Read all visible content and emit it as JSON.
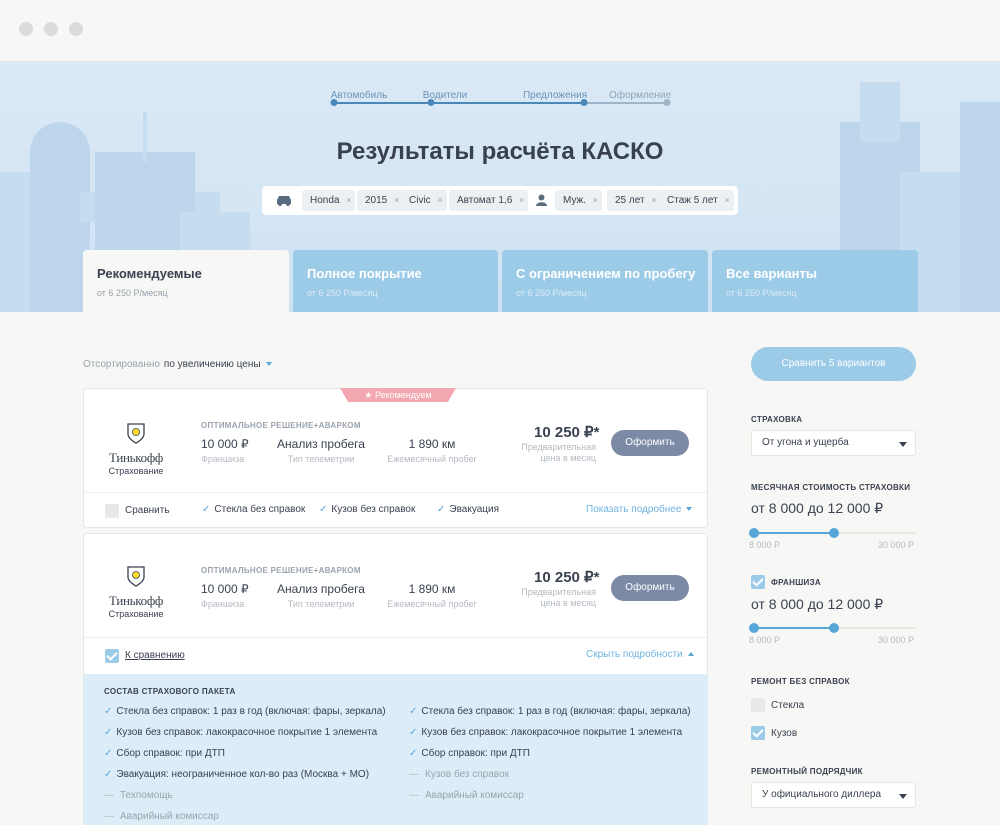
{
  "steps": [
    "Автомобиль",
    "Водители",
    "Предложения",
    "Оформление"
  ],
  "title": "Результаты расчёта КАСКО",
  "car_chips": [
    "Honda",
    "2015",
    "Civic",
    "Автомат 1,6"
  ],
  "driver_chips": [
    "Муж.",
    "25 лет",
    "Стаж 5 лет"
  ],
  "remove_glyph": "×",
  "tabs": [
    {
      "title": "Рекомендуемые",
      "sub": "от 6 250 Р/месяц"
    },
    {
      "title": "Полное покрытие",
      "sub": "от 6 250 Р/месяц"
    },
    {
      "title": "С ограничением по пробегу",
      "sub": "от 6 250 Р/месяц"
    },
    {
      "title": "Все варианты",
      "sub": "от 6 250 Р/месяц"
    }
  ],
  "sort": {
    "label": "Отсортированно",
    "value": "по увеличению цены"
  },
  "offers": [
    {
      "badge": "Рекомендуем",
      "company": "Тинькофф",
      "company_sub": "Страхование",
      "plan": "ОПТИМАЛЬНОЕ РЕШЕНИЕ+АВАРКОМ",
      "franchise": {
        "value": "10 000 ₽",
        "label": "Франшиза"
      },
      "telemetry": {
        "value": "Анализ пробега",
        "label": "Тип телеметрии"
      },
      "mileage": {
        "value": "1 890 км",
        "label": "Ежемесячный пробег"
      },
      "price": "10 250 ₽*",
      "price_note": "Предварительная цена в месяц",
      "cta": "Оформить",
      "compare": "Сравнить",
      "features": [
        "Стекла без справок",
        "Кузов без справок",
        "Эвакуация"
      ],
      "details_link": "Показать подробнее"
    },
    {
      "company": "Тинькофф",
      "company_sub": "Страхование",
      "plan": "ОПТИМАЛЬНОЕ РЕШЕНИЕ+АВАРКОМ",
      "franchise": {
        "value": "10 000 ₽",
        "label": "Франшиза"
      },
      "telemetry": {
        "value": "Анализ пробега",
        "label": "Тип телеметрии"
      },
      "mileage": {
        "value": "1 890 км",
        "label": "Ежемесячный пробег"
      },
      "price": "10 250 ₽*",
      "price_note": "Предварительная цена в месяц",
      "cta": "Оформить",
      "compare": "К сравнению",
      "details_link": "Скрыть подробности"
    }
  ],
  "package": {
    "title": "СОСТАВ СТРАХОВОГО ПАКЕТА",
    "left": [
      {
        "text": "Стекла без справок: 1 раз в год (включая: фары, зеркала)",
        "on": true
      },
      {
        "text": "Кузов без справок: лакокрасочное покрытие 1 элемента",
        "on": true
      },
      {
        "text": "Сбор справок: при ДТП",
        "on": true
      },
      {
        "text": "Эвакуация: неограниченное кол-во раз (Москва + МО)",
        "on": true
      },
      {
        "text": "Техпомощь",
        "on": false
      },
      {
        "text": "Аварийный комиссар",
        "on": false
      }
    ],
    "right": [
      {
        "text": "Стекла без справок: 1 раз в год (включая: фары, зеркала)",
        "on": true
      },
      {
        "text": "Кузов без справок: лакокрасочное покрытие 1 элемента",
        "on": true
      },
      {
        "text": "Сбор справок: при ДТП",
        "on": true
      },
      {
        "text": "Кузов без справок",
        "on": false
      },
      {
        "text": "Аварийный комиссар",
        "on": false
      }
    ]
  },
  "filters": {
    "compare_button": "Сравнить 5 вариантов",
    "insurance_label": "СТРАХОВКА",
    "insurance_value": "От угона и ущерба",
    "cost_label": "МЕСЯЧНАЯ СТОИМОСТЬ СТРАХОВКИ",
    "cost_range": "от 8 000 до 12 000 ₽",
    "cost_slider": {
      "min_label": "8 000 Р",
      "max_label": "30 000 Р",
      "low": 8000,
      "high": 12000,
      "min": 8000,
      "max": 30000
    },
    "franchise_label": "ФРАНШИЗА",
    "franchise_range": "от 8 000 до 12 000 ₽",
    "franchise_slider": {
      "min_label": "8 000 Р",
      "max_label": "30 000 Р",
      "low": 8000,
      "high": 12000,
      "min": 8000,
      "max": 30000
    },
    "repair_label": "РЕМОНТ БЕЗ СПРАВОК",
    "repair_options": [
      {
        "label": "Стекла",
        "checked": false
      },
      {
        "label": "Кузов",
        "checked": true
      }
    ],
    "contractor_label": "РЕМОНТНЫЙ ПОДРЯДЧИК",
    "contractor_value": "У официального диллера"
  }
}
